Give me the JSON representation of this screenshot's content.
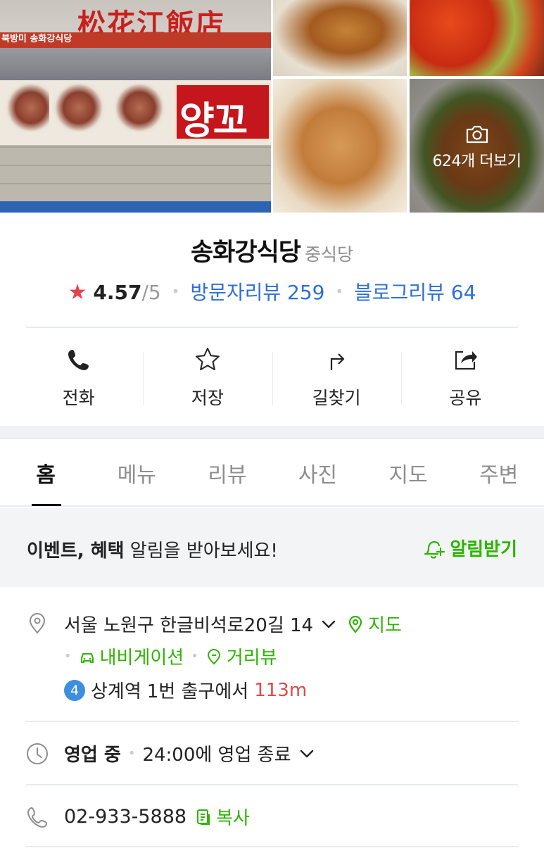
{
  "photos": {
    "storefront_sign_hanja": "松花江飯店",
    "storefront_sign_sub": "북방미 송화강식당",
    "storefront_board_text": "양꼬치",
    "more_photos_label": "624개 더보기"
  },
  "place": {
    "name": "송화강식당",
    "category": "중식당",
    "rating": "4.57",
    "rating_max": "/5",
    "visitor_reviews": "방문자리뷰 259",
    "blog_reviews": "블로그리뷰 64"
  },
  "actions": [
    {
      "label": "전화",
      "icon": "phone-icon"
    },
    {
      "label": "저장",
      "icon": "star-outline-icon"
    },
    {
      "label": "길찾기",
      "icon": "directions-icon"
    },
    {
      "label": "공유",
      "icon": "share-icon"
    }
  ],
  "tabs": [
    "홈",
    "메뉴",
    "리뷰",
    "사진",
    "지도",
    "주변"
  ],
  "active_tab": "홈",
  "event": {
    "bold_text": "이벤트, 혜택",
    "text": " 알림을 받아보세요!",
    "notify_label": "알림받기"
  },
  "info": {
    "address": "서울 노원구 한글비석로20길 14",
    "map_label": "지도",
    "navigation_label": "내비게이션",
    "street_view_label": "거리뷰",
    "subway_line": "4",
    "subway_station": "상계역",
    "subway_exit_text": "1번 출구에서",
    "subway_distance": "113m",
    "status": "영업 중",
    "hours_text": "24:00에 영업 종료",
    "phone": "02-933-5888",
    "copy_label": "복사"
  },
  "colors": {
    "accent_green": "#2db400",
    "link_blue": "#2d6ed5",
    "star_red": "#e7414b",
    "distance_red": "#e04848",
    "subway_line4_blue": "#3e8ede"
  }
}
